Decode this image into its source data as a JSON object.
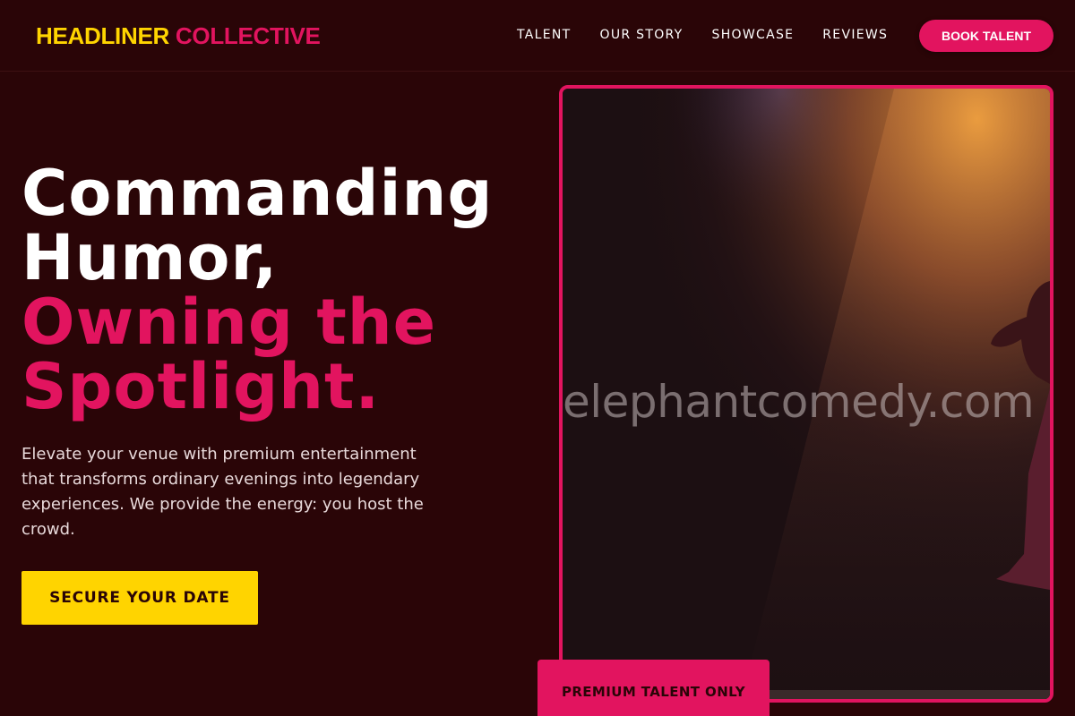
{
  "brand": {
    "word1": "HEADLINER",
    "word2": "COLLECTIVE"
  },
  "nav": {
    "items": [
      {
        "label": "TALENT"
      },
      {
        "label": "OUR STORY"
      },
      {
        "label": "SHOWCASE"
      },
      {
        "label": "REVIEWS"
      }
    ],
    "book_label": "BOOK TALENT"
  },
  "hero": {
    "line1": "Commanding",
    "line2": "Humor,",
    "line3": "Owning the",
    "line4": "Spotlight.",
    "description": "Elevate your venue with premium entertainment that transforms ordinary evenings into legendary experiences. We provide the energy: you host the crowd.",
    "cta_label": "SECURE YOUR DATE"
  },
  "image": {
    "watermark": "elephantcomedy.com",
    "badge": "PREMIUM TALENT ONLY"
  },
  "colors": {
    "background": "#2a0507",
    "accent_pink": "#e2145f",
    "accent_yellow": "#ffd400"
  }
}
